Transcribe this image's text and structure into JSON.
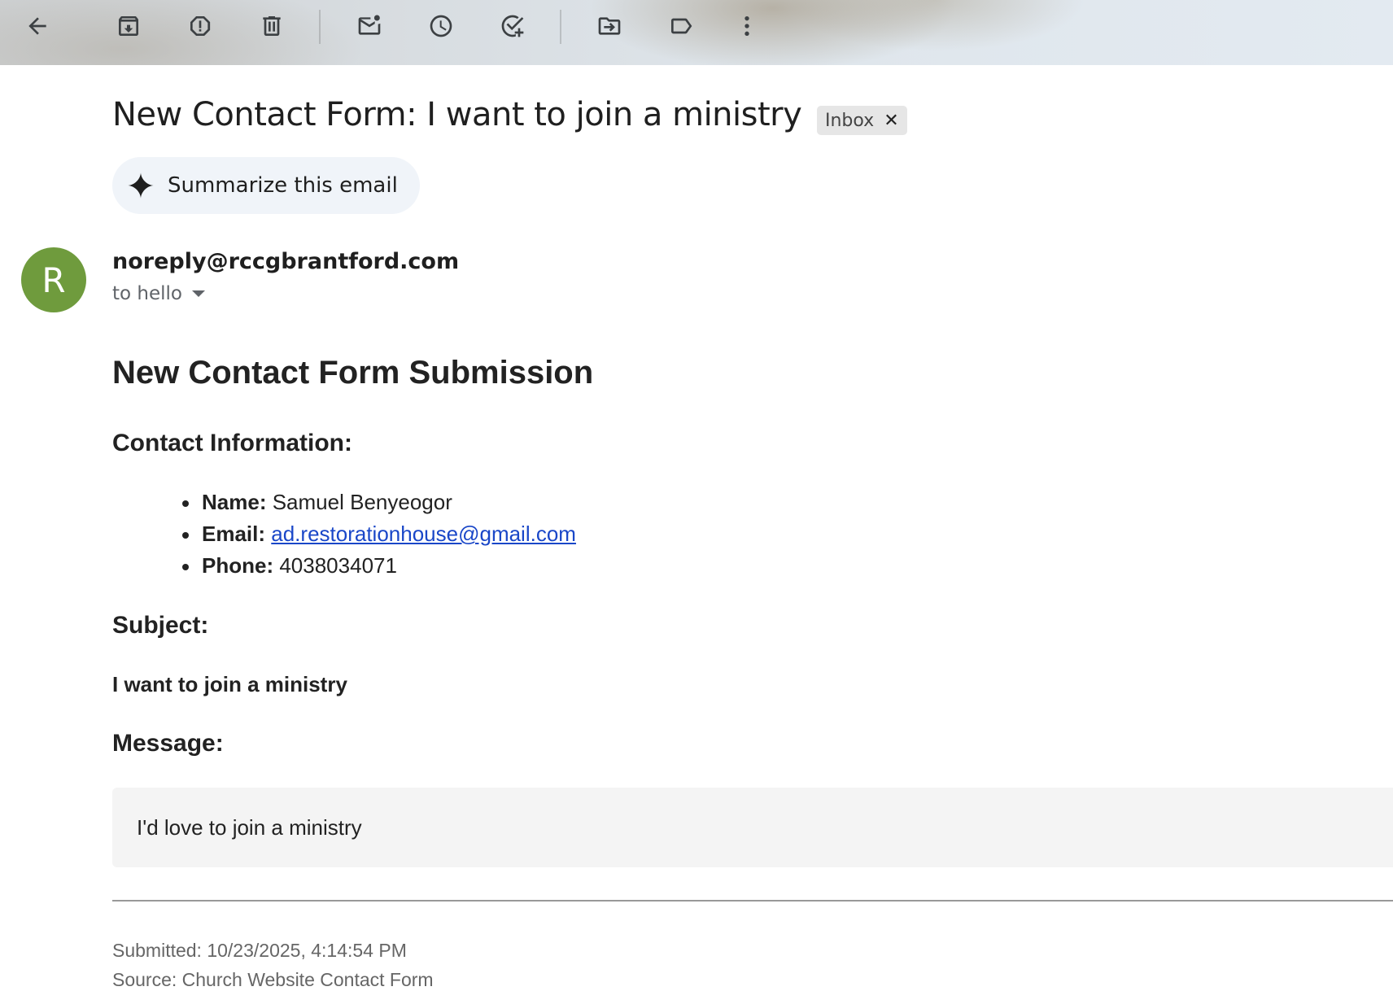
{
  "toolbar": {
    "buttons": [
      {
        "name": "back",
        "icon": "arrow-left-icon"
      },
      {
        "name": "archive",
        "icon": "archive-icon"
      },
      {
        "name": "report-spam",
        "icon": "report-icon"
      },
      {
        "name": "delete",
        "icon": "trash-icon"
      },
      {
        "name": "mark-unread",
        "icon": "mail-unread-icon"
      },
      {
        "name": "snooze",
        "icon": "clock-icon"
      },
      {
        "name": "add-to-tasks",
        "icon": "add-task-icon"
      },
      {
        "name": "move-to",
        "icon": "folder-move-icon"
      },
      {
        "name": "labels",
        "icon": "label-icon"
      },
      {
        "name": "more",
        "icon": "more-vert-icon"
      }
    ]
  },
  "email": {
    "subject": "New Contact Form: I want to join a ministry",
    "label": "Inbox",
    "summarize_label": "Summarize this email",
    "avatar_letter": "R",
    "avatar_color": "#6f9b3d",
    "sender": "noreply@rccgbrantford.com",
    "recipients": "to hello"
  },
  "content": {
    "heading": "New Contact Form Submission",
    "contact_heading": "Contact Information:",
    "contact": {
      "name_label": "Name:",
      "name_value": "Samuel Benyeogor",
      "email_label": "Email:",
      "email_value": "ad.restorationhouse@gmail.com",
      "phone_label": "Phone:",
      "phone_value": "4038034071"
    },
    "subject_heading": "Subject:",
    "subject_value": "I want to join a ministry",
    "message_heading": "Message:",
    "message_value": "I'd love to join a ministry",
    "submitted": "Submitted: 10/23/2025, 4:14:54 PM",
    "source": "Source: Church Website Contact Form"
  },
  "colors": {
    "link": "#1a47c8",
    "summarize_bg": "#f0f4f9"
  }
}
